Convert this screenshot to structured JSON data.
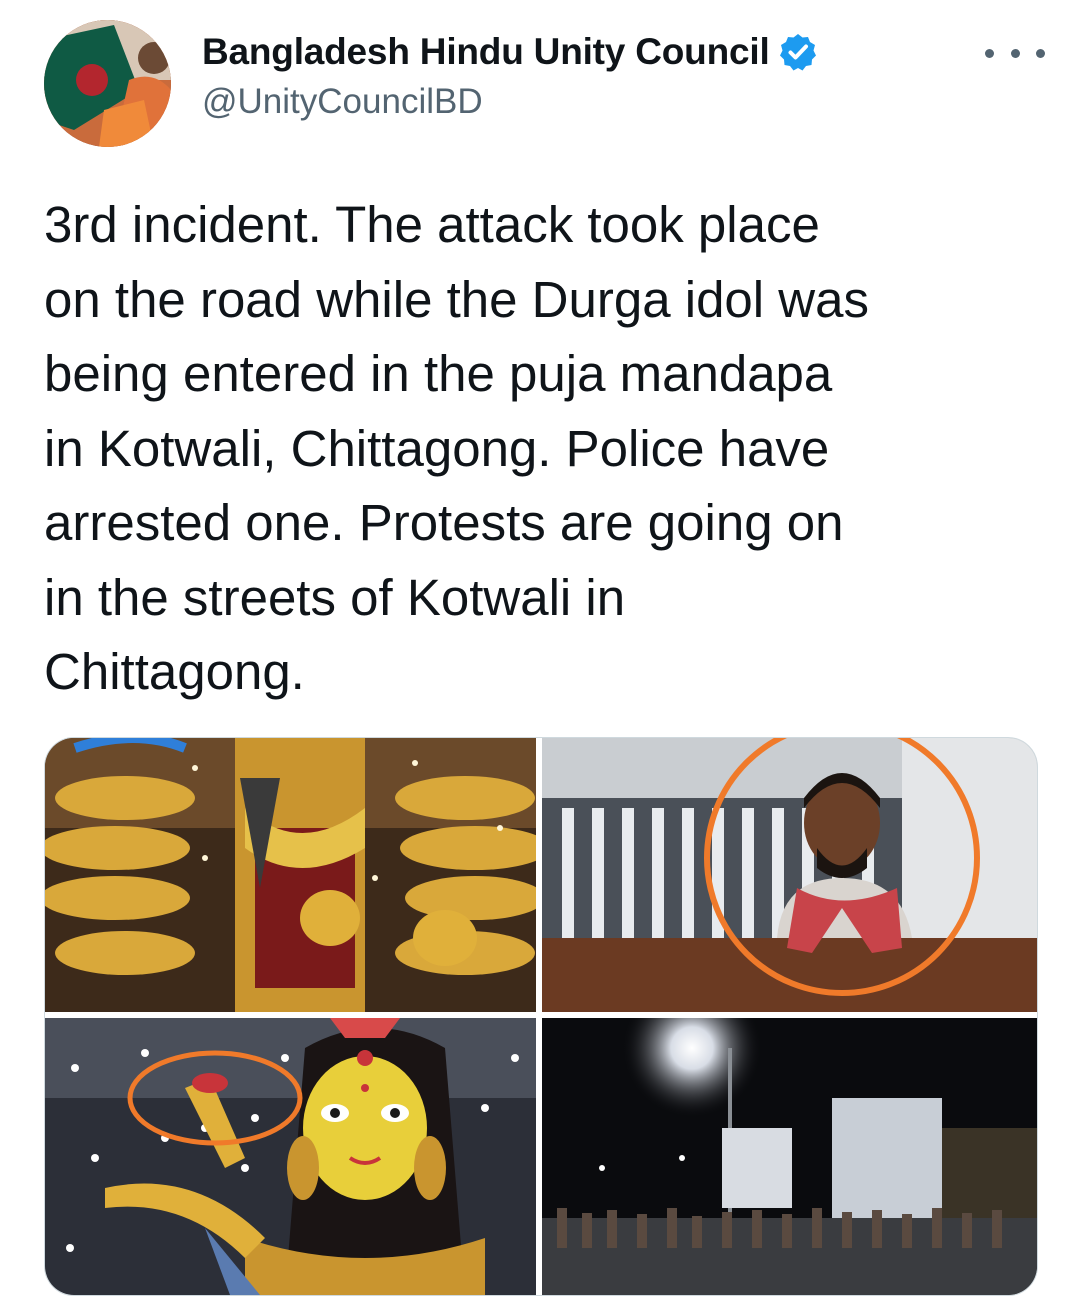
{
  "author": {
    "display_name": "Bangladesh Hindu Unity Council",
    "handle": "@UnityCouncilBD",
    "verified": true,
    "avatar_icon": "profile-photo"
  },
  "more_icon": "more-options-icon",
  "tweet": {
    "text_lines": [
      "3rd incident. The attack took place",
      "on the road while the Durga idol was",
      "being entered in the puja mandapa",
      "in Kotwali, Chittagong. Police have",
      "arrested one. Protests are going on",
      "in the streets of Kotwali in",
      "Chittagong."
    ]
  },
  "colors": {
    "text": "#0f1419",
    "secondary": "#536471",
    "verified_blue": "#1d9bf0",
    "highlight_circle": "#f07a2a",
    "border": "#cfd9de"
  },
  "media": [
    {
      "kind": "photo",
      "subject": "durga-idol-arms"
    },
    {
      "kind": "photo",
      "subject": "arrested-man"
    },
    {
      "kind": "photo",
      "subject": "durga-idol-face"
    },
    {
      "kind": "photo",
      "subject": "street-protest-night"
    }
  ]
}
